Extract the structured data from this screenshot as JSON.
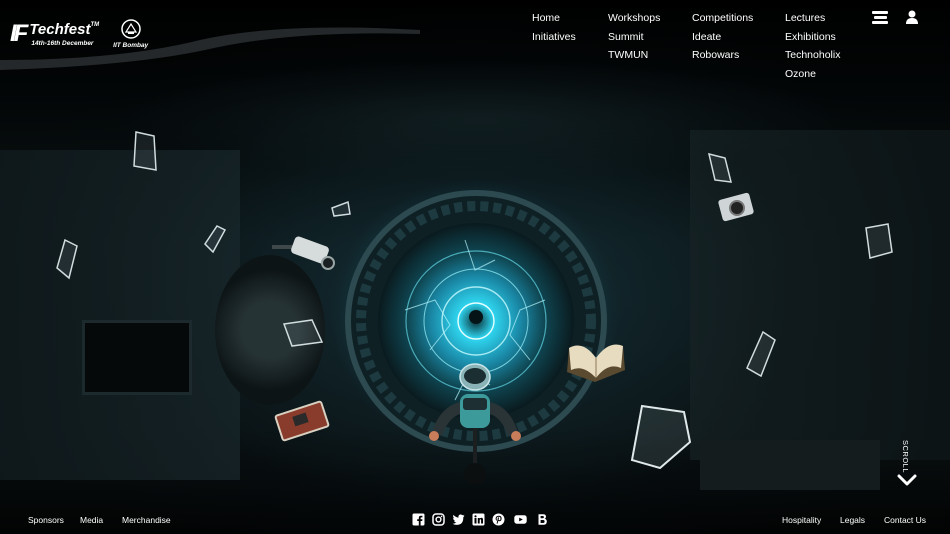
{
  "brand": {
    "mark": "IF",
    "name": "Techfest",
    "trademark": "TM",
    "dates": "14th-16th December",
    "institute": "IIT Bombay"
  },
  "nav": {
    "columns": [
      [
        "Home",
        "Initiatives"
      ],
      [
        "Workshops",
        "Summit",
        "TWMUN"
      ],
      [
        "Competitions",
        "Ideate",
        "Robowars"
      ],
      [
        "Lectures",
        "Exhibitions",
        "Technoholix",
        "Ozone"
      ]
    ]
  },
  "header_icons": {
    "menu": "hamburger-icon",
    "user": "user-icon"
  },
  "scroll": {
    "label": "SCROLL",
    "icon": "chevron-down-icon"
  },
  "footer": {
    "left_links": [
      "Sponsors",
      "Media",
      "Merchandise"
    ],
    "right_links": [
      "Hospitality",
      "Legals",
      "Contact Us"
    ],
    "social_icons": [
      "facebook-icon",
      "instagram-icon",
      "twitter-icon",
      "linkedin-icon",
      "pinterest-icon",
      "youtube-icon",
      "blog-icon"
    ]
  },
  "colors": {
    "background": "#000000",
    "text": "#ffffff",
    "portal_glow": "#3cc8e6"
  }
}
